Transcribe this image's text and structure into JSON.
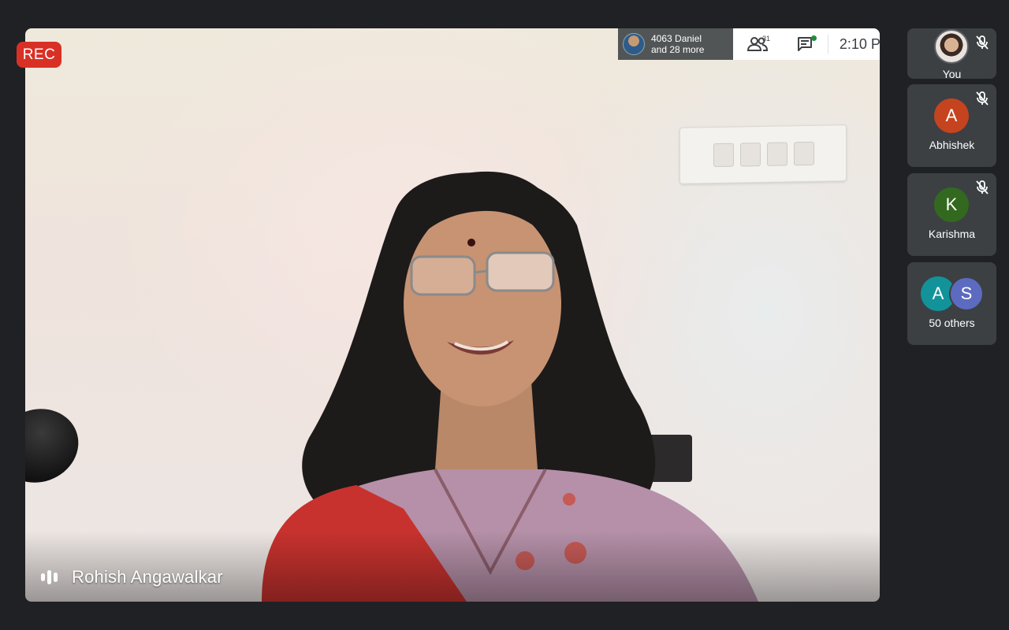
{
  "recording": {
    "label": "REC",
    "color": "#d93025"
  },
  "main_tile": {
    "speaker_name": "Rohish Angawalkar",
    "speaking_indicator_icon": "audio-levels-icon"
  },
  "top_bar": {
    "speaking_chip_line1": "4063 Daniel",
    "speaking_chip_line2": "and 28 more",
    "people_icon": "people-icon",
    "people_count": "31",
    "chat_icon": "chat-icon",
    "time": "2:10 P"
  },
  "participants": [
    {
      "name": "You",
      "avatar_type": "photo",
      "muted": true,
      "mute_icon": "mic-off-icon"
    },
    {
      "name": "Abhishek",
      "initial": "A",
      "avatar_color": "#c5441f",
      "muted": true,
      "mute_icon": "mic-off-icon"
    },
    {
      "name": "Karishma",
      "initial": "K",
      "avatar_color": "#33691e",
      "muted": true,
      "mute_icon": "mic-off-icon"
    }
  ],
  "others_tile": {
    "label": "50 others",
    "avatars": [
      {
        "initial": "A",
        "color": "#12939a"
      },
      {
        "initial": "S",
        "color": "#5c6bc0"
      }
    ]
  },
  "colors": {
    "background": "#202124",
    "tile_background": "#3c4043",
    "toolbar_background": "#ffffff"
  }
}
